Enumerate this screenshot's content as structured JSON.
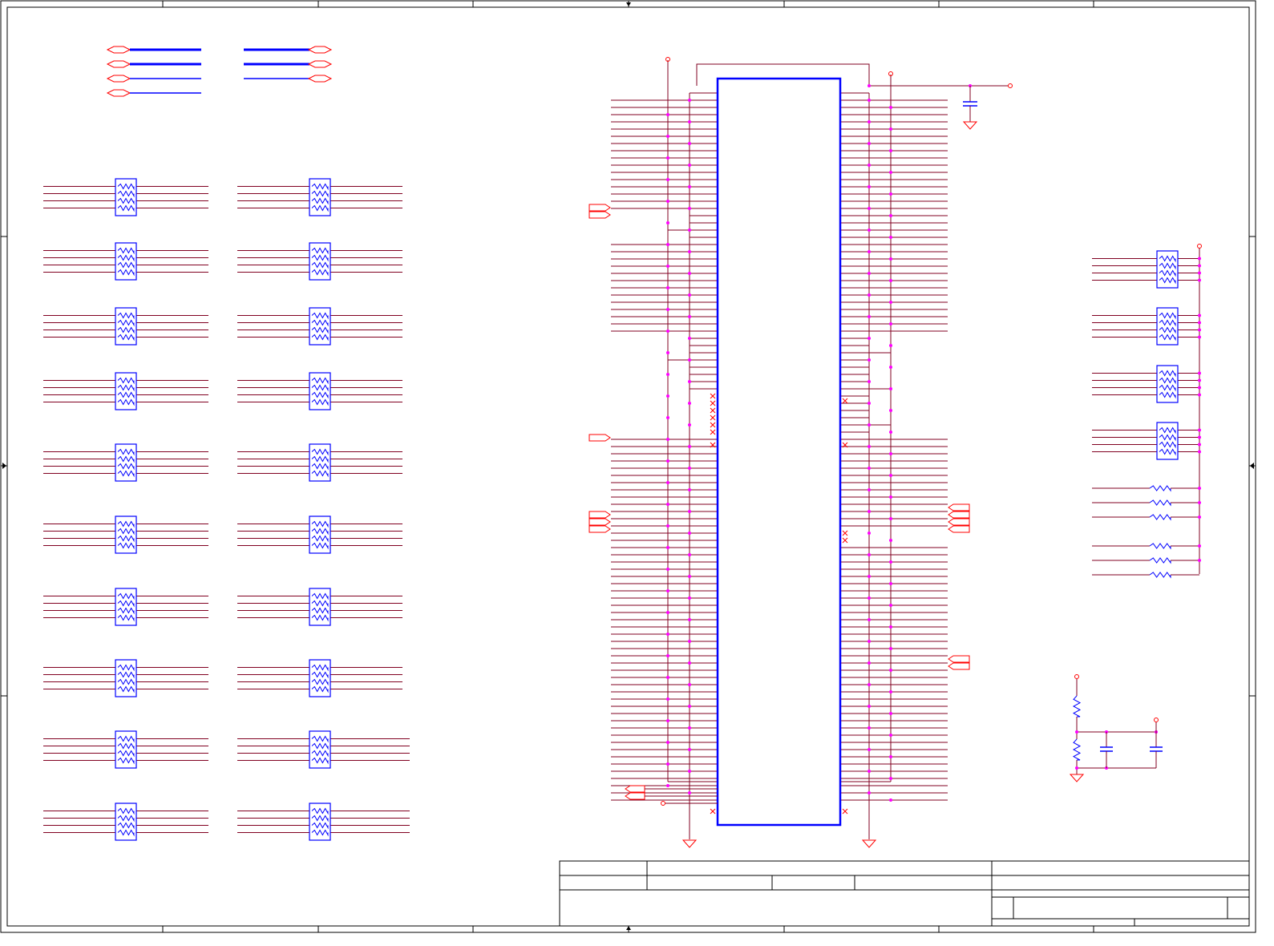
{
  "sheet": {
    "background": "#ffffff",
    "border_color": "#000000",
    "wire_color": "#800020",
    "component_color": "#0000ff",
    "port_color": "#ff0000",
    "junction_color": "#ff00ff"
  },
  "bus_entries": {
    "left_group_count": 4,
    "right_group_count": 3
  },
  "resistor_packs": {
    "left_columns": 2,
    "rows_per_column": 10,
    "right_column_count": 4,
    "discrete_resistor_count": 6
  },
  "connector": {
    "pins_per_side": 35
  },
  "title_block": {
    "cells": [
      "",
      "",
      "",
      "",
      "",
      "",
      ""
    ]
  }
}
